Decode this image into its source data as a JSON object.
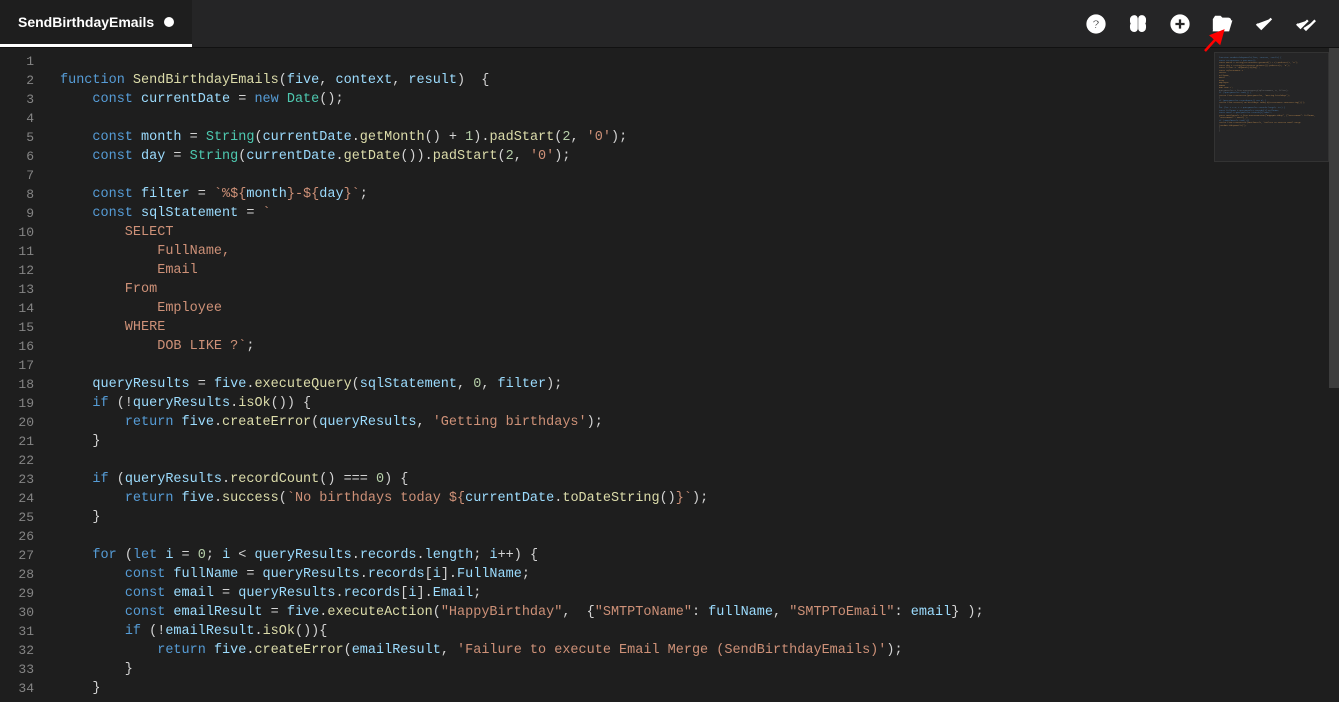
{
  "tab": {
    "title": "SendBirthdayEmails",
    "dirty": true
  },
  "toolbar": {
    "help": "help-icon",
    "brain": "brain-icon",
    "add": "add-icon",
    "open": "open-folder-icon",
    "check": "check-icon",
    "checkall": "check-all-icon"
  },
  "arrow_target": "check-icon",
  "code": {
    "lines": [
      {
        "n": 1,
        "t": []
      },
      {
        "n": 2,
        "t": [
          [
            "kw",
            "function "
          ],
          [
            "fn",
            "SendBirthdayEmails"
          ],
          [
            "op",
            "("
          ],
          [
            "id",
            "five"
          ],
          [
            "op",
            ", "
          ],
          [
            "id",
            "context"
          ],
          [
            "op",
            ", "
          ],
          [
            "id",
            "result"
          ],
          [
            "op",
            ")  {"
          ]
        ]
      },
      {
        "n": 3,
        "t": [
          [
            "op",
            "    "
          ],
          [
            "kw",
            "const "
          ],
          [
            "id",
            "currentDate"
          ],
          [
            "op",
            " = "
          ],
          [
            "kw",
            "new "
          ],
          [
            "cls",
            "Date"
          ],
          [
            "op",
            "();"
          ]
        ]
      },
      {
        "n": 4,
        "t": []
      },
      {
        "n": 5,
        "t": [
          [
            "op",
            "    "
          ],
          [
            "kw",
            "const "
          ],
          [
            "id",
            "month"
          ],
          [
            "op",
            " = "
          ],
          [
            "cls",
            "String"
          ],
          [
            "op",
            "("
          ],
          [
            "id",
            "currentDate"
          ],
          [
            "op",
            "."
          ],
          [
            "fn",
            "getMonth"
          ],
          [
            "op",
            "() + "
          ],
          [
            "num",
            "1"
          ],
          [
            "op",
            ")."
          ],
          [
            "fn",
            "padStart"
          ],
          [
            "op",
            "("
          ],
          [
            "num",
            "2"
          ],
          [
            "op",
            ", "
          ],
          [
            "str",
            "'0'"
          ],
          [
            "op",
            ");"
          ]
        ]
      },
      {
        "n": 6,
        "t": [
          [
            "op",
            "    "
          ],
          [
            "kw",
            "const "
          ],
          [
            "id",
            "day"
          ],
          [
            "op",
            " = "
          ],
          [
            "cls",
            "String"
          ],
          [
            "op",
            "("
          ],
          [
            "id",
            "currentDate"
          ],
          [
            "op",
            "."
          ],
          [
            "fn",
            "getDate"
          ],
          [
            "op",
            "())."
          ],
          [
            "fn",
            "padStart"
          ],
          [
            "op",
            "("
          ],
          [
            "num",
            "2"
          ],
          [
            "op",
            ", "
          ],
          [
            "str",
            "'0'"
          ],
          [
            "op",
            ");"
          ]
        ]
      },
      {
        "n": 7,
        "t": []
      },
      {
        "n": 8,
        "t": [
          [
            "op",
            "    "
          ],
          [
            "kw",
            "const "
          ],
          [
            "id",
            "filter"
          ],
          [
            "op",
            " = "
          ],
          [
            "str",
            "`%${"
          ],
          [
            "id",
            "month"
          ],
          [
            "str",
            "}-${"
          ],
          [
            "id",
            "day"
          ],
          [
            "str",
            "}`"
          ],
          [
            "op",
            ";"
          ]
        ]
      },
      {
        "n": 9,
        "t": [
          [
            "op",
            "    "
          ],
          [
            "kw",
            "const "
          ],
          [
            "id",
            "sqlStatement"
          ],
          [
            "op",
            " = "
          ],
          [
            "str",
            "`"
          ]
        ]
      },
      {
        "n": 10,
        "t": [
          [
            "str",
            "        SELECT"
          ]
        ]
      },
      {
        "n": 11,
        "t": [
          [
            "str",
            "            FullName,"
          ]
        ]
      },
      {
        "n": 12,
        "t": [
          [
            "str",
            "            Email"
          ]
        ]
      },
      {
        "n": 13,
        "t": [
          [
            "str",
            "        From"
          ]
        ]
      },
      {
        "n": 14,
        "t": [
          [
            "str",
            "            Employee"
          ]
        ]
      },
      {
        "n": 15,
        "t": [
          [
            "str",
            "        WHERE"
          ]
        ]
      },
      {
        "n": 16,
        "t": [
          [
            "str",
            "            DOB LIKE ?`"
          ],
          [
            "op",
            ";"
          ]
        ]
      },
      {
        "n": 17,
        "t": []
      },
      {
        "n": 18,
        "t": [
          [
            "op",
            "    "
          ],
          [
            "id",
            "queryResults"
          ],
          [
            "op",
            " = "
          ],
          [
            "id",
            "five"
          ],
          [
            "op",
            "."
          ],
          [
            "fn",
            "executeQuery"
          ],
          [
            "op",
            "("
          ],
          [
            "id",
            "sqlStatement"
          ],
          [
            "op",
            ", "
          ],
          [
            "num",
            "0"
          ],
          [
            "op",
            ", "
          ],
          [
            "id",
            "filter"
          ],
          [
            "op",
            ");"
          ]
        ]
      },
      {
        "n": 19,
        "t": [
          [
            "op",
            "    "
          ],
          [
            "kw",
            "if"
          ],
          [
            "op",
            " (!"
          ],
          [
            "id",
            "queryResults"
          ],
          [
            "op",
            "."
          ],
          [
            "fn",
            "isOk"
          ],
          [
            "op",
            "()) {"
          ]
        ]
      },
      {
        "n": 20,
        "t": [
          [
            "op",
            "        "
          ],
          [
            "kw",
            "return "
          ],
          [
            "id",
            "five"
          ],
          [
            "op",
            "."
          ],
          [
            "fn",
            "createError"
          ],
          [
            "op",
            "("
          ],
          [
            "id",
            "queryResults"
          ],
          [
            "op",
            ", "
          ],
          [
            "str",
            "'Getting birthdays'"
          ],
          [
            "op",
            ");"
          ]
        ]
      },
      {
        "n": 21,
        "t": [
          [
            "op",
            "    }"
          ]
        ]
      },
      {
        "n": 22,
        "t": []
      },
      {
        "n": 23,
        "t": [
          [
            "op",
            "    "
          ],
          [
            "kw",
            "if"
          ],
          [
            "op",
            " ("
          ],
          [
            "id",
            "queryResults"
          ],
          [
            "op",
            "."
          ],
          [
            "fn",
            "recordCount"
          ],
          [
            "op",
            "() === "
          ],
          [
            "num",
            "0"
          ],
          [
            "op",
            ") {"
          ]
        ]
      },
      {
        "n": 24,
        "t": [
          [
            "op",
            "        "
          ],
          [
            "kw",
            "return "
          ],
          [
            "id",
            "five"
          ],
          [
            "op",
            "."
          ],
          [
            "fn",
            "success"
          ],
          [
            "op",
            "("
          ],
          [
            "str",
            "`No birthdays today ${"
          ],
          [
            "id",
            "currentDate"
          ],
          [
            "op",
            "."
          ],
          [
            "fn",
            "toDateString"
          ],
          [
            "op",
            "()"
          ],
          [
            "str",
            "}`"
          ],
          [
            "op",
            ");"
          ]
        ]
      },
      {
        "n": 25,
        "t": [
          [
            "op",
            "    }"
          ]
        ]
      },
      {
        "n": 26,
        "t": []
      },
      {
        "n": 27,
        "t": [
          [
            "op",
            "    "
          ],
          [
            "kw",
            "for"
          ],
          [
            "op",
            " ("
          ],
          [
            "kw",
            "let "
          ],
          [
            "id",
            "i"
          ],
          [
            "op",
            " = "
          ],
          [
            "num",
            "0"
          ],
          [
            "op",
            "; "
          ],
          [
            "id",
            "i"
          ],
          [
            "op",
            " < "
          ],
          [
            "id",
            "queryResults"
          ],
          [
            "op",
            "."
          ],
          [
            "prop",
            "records"
          ],
          [
            "op",
            "."
          ],
          [
            "prop",
            "length"
          ],
          [
            "op",
            "; "
          ],
          [
            "id",
            "i"
          ],
          [
            "op",
            "++) {"
          ]
        ]
      },
      {
        "n": 28,
        "t": [
          [
            "op",
            "        "
          ],
          [
            "kw",
            "const "
          ],
          [
            "id",
            "fullName"
          ],
          [
            "op",
            " = "
          ],
          [
            "id",
            "queryResults"
          ],
          [
            "op",
            "."
          ],
          [
            "prop",
            "records"
          ],
          [
            "op",
            "["
          ],
          [
            "id",
            "i"
          ],
          [
            "op",
            "]."
          ],
          [
            "prop",
            "FullName"
          ],
          [
            "op",
            ";"
          ]
        ]
      },
      {
        "n": 29,
        "t": [
          [
            "op",
            "        "
          ],
          [
            "kw",
            "const "
          ],
          [
            "id",
            "email"
          ],
          [
            "op",
            " = "
          ],
          [
            "id",
            "queryResults"
          ],
          [
            "op",
            "."
          ],
          [
            "prop",
            "records"
          ],
          [
            "op",
            "["
          ],
          [
            "id",
            "i"
          ],
          [
            "op",
            "]."
          ],
          [
            "prop",
            "Email"
          ],
          [
            "op",
            ";"
          ]
        ]
      },
      {
        "n": 30,
        "t": [
          [
            "op",
            "        "
          ],
          [
            "kw",
            "const "
          ],
          [
            "id",
            "emailResult"
          ],
          [
            "op",
            " = "
          ],
          [
            "id",
            "five"
          ],
          [
            "op",
            "."
          ],
          [
            "fn",
            "executeAction"
          ],
          [
            "op",
            "("
          ],
          [
            "str",
            "\"HappyBirthday\""
          ],
          [
            "op",
            ",  {"
          ],
          [
            "str",
            "\"SMTPToName\""
          ],
          [
            "op",
            ": "
          ],
          [
            "id",
            "fullName"
          ],
          [
            "op",
            ", "
          ],
          [
            "str",
            "\"SMTPToEmail\""
          ],
          [
            "op",
            ": "
          ],
          [
            "id",
            "email"
          ],
          [
            "op",
            "} );"
          ]
        ]
      },
      {
        "n": 31,
        "t": [
          [
            "op",
            "        "
          ],
          [
            "kw",
            "if"
          ],
          [
            "op",
            " (!"
          ],
          [
            "id",
            "emailResult"
          ],
          [
            "op",
            "."
          ],
          [
            "fn",
            "isOk"
          ],
          [
            "op",
            "()){"
          ]
        ]
      },
      {
        "n": 32,
        "t": [
          [
            "op",
            "            "
          ],
          [
            "kw",
            "return "
          ],
          [
            "id",
            "five"
          ],
          [
            "op",
            "."
          ],
          [
            "fn",
            "createError"
          ],
          [
            "op",
            "("
          ],
          [
            "id",
            "emailResult"
          ],
          [
            "op",
            ", "
          ],
          [
            "str",
            "'Failure to execute Email Merge (SendBirthdayEmails)'"
          ],
          [
            "op",
            ");"
          ]
        ]
      },
      {
        "n": 33,
        "t": [
          [
            "op",
            "        }"
          ]
        ]
      },
      {
        "n": 34,
        "t": [
          [
            "op",
            "    }"
          ]
        ]
      }
    ]
  }
}
